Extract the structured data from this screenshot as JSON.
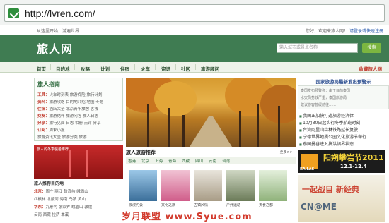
{
  "browser": {
    "url": "http://lvren.com/"
  },
  "topinfo": {
    "left": "从这里开始，游遍世界",
    "right_prefix": "您好，欢迎来旅人网！",
    "right_link": "请登录或快速注册"
  },
  "header": {
    "logo": "旅人网",
    "search_placeholder": "输入城市或景点名称",
    "search_button": "搜索"
  },
  "nav": {
    "items": [
      "首页",
      "目的地",
      "攻略",
      "计划",
      "住宿",
      "火车",
      "资讯",
      "社区",
      "旅游顾问"
    ],
    "right": "收藏旅人网"
  },
  "guide": {
    "title": "旅人指南",
    "rows": [
      {
        "key": "工具：",
        "text": "火车时刻表 旅游保险 旅行计划"
      },
      {
        "key": "资料：",
        "text": "旅游攻略 目的地介绍 地图 专题"
      },
      {
        "key": "住宿：",
        "text": "酒店大全 北京青年旅舍 客栈"
      },
      {
        "key": "交友：",
        "text": "旅游结伴 旅游问答 旅人日志"
      },
      {
        "key": "分享：",
        "text": "旅行见闻 日志 相册 点评 分享"
      },
      {
        "key": "订阅：",
        "text": "周末小报"
      },
      {
        "key": "",
        "text": "旅游资讯大全 旅游分类 旅游"
      }
    ]
  },
  "jacket_ad": {
    "label": "旅人的冬季装备推荐"
  },
  "dests": {
    "title": "旅人推荐目的地",
    "rows": [
      {
        "key": "北京：",
        "text": "周庄 丽江 鼓浪屿 峨眉山"
      },
      {
        "key": "",
        "text": "红枫林 北戴河 海南 乌镇 黄山"
      },
      {
        "key": "华东：",
        "text": "九寨沟 张家界 峨眉山 敦煌"
      },
      {
        "key": "",
        "text": "云南 西藏 拉萨 本溪"
      }
    ]
  },
  "news": {
    "head": "国家旅游局最新发出预警示",
    "box_lines": [
      "泰国发布预警称：由于目前泰国",
      "水灾局势较严重，泰国旅游局",
      "建议游客暂缓前往……"
    ],
    "items": [
      "我国正加快打造旅游经济体",
      "10月30日起实行冬季航班时刻",
      "台湾阿里山森林铁路延长复驶",
      "宁德世界地质公园文化旅游节举行",
      "泰国曼谷进入抗洪临界状态"
    ]
  },
  "rec": {
    "title": "旅人旅游推荐",
    "more": "更多>>",
    "tabs": [
      "香港",
      "北京",
      "上海",
      "青海",
      "西藏",
      "四川",
      "云南",
      "台湾"
    ],
    "captions": [
      "浪漫约会",
      "文化之旅",
      "古镇风情",
      "户外运动",
      "美食之都"
    ]
  },
  "ads": {
    "kailas_brand": "KAILAS",
    "festival": "阳朔攀岩节2011",
    "festival_date": "12.1-12.4",
    "ad2_line1": "一起战目 新经典",
    "ad2_line2": "CN@ME"
  },
  "watermark": "岁月联盟 www.Syue.com",
  "colors": {
    "brand_green": "#3f7c52",
    "accent_red": "#c0392b"
  }
}
